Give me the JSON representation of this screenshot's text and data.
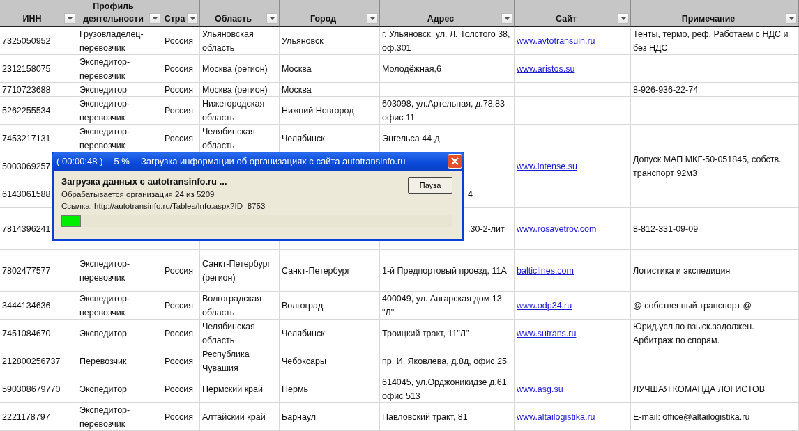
{
  "table": {
    "columns": [
      {
        "label": "ИНН",
        "kind": "text"
      },
      {
        "label": "Профиль деятельности",
        "kind": "text"
      },
      {
        "label": "Стра",
        "kind": "text"
      },
      {
        "label": "Область",
        "kind": "text"
      },
      {
        "label": "Город",
        "kind": "text"
      },
      {
        "label": "Адрес",
        "kind": "text"
      },
      {
        "label": "Сайт",
        "kind": "link"
      },
      {
        "label": "Примечание",
        "kind": "text"
      }
    ],
    "rows": [
      {
        "cells": [
          "7325050952",
          "Грузовладелец-перевозчик",
          "Россия",
          "Ульяновская область",
          "Ульяновск",
          "г. Ульяновск, ул. Л. Толстого 38, оф.301",
          "www.avtotransuln.ru",
          "Тенты, термо, реф. Работаем с НДС и без НДС"
        ]
      },
      {
        "cells": [
          "2312158075",
          "Экспедитор-перевозчик",
          "Россия",
          "Москва (регион)",
          "Москва",
          "Молодёжная,6",
          "www.aristos.su",
          null
        ]
      },
      {
        "cells": [
          "7710723688",
          "Экспедитор",
          "Россия",
          "Москва (регион)",
          "Москва",
          null,
          null,
          "8-926-936-22-74"
        ]
      },
      {
        "cells": [
          "5262255534",
          "Экспедитор-перевозчик",
          "Россия",
          "Нижегородская область",
          "Нижний Новгород",
          "603098, ул.Артельная, д.78,83 офис 11",
          null,
          null
        ]
      },
      {
        "cells": [
          "7453217131",
          "Экспедитор-перевозчик",
          "Россия",
          "Челябинская область",
          "Челябинск",
          "Энгельса 44-д",
          null,
          null
        ]
      },
      {
        "cells": [
          "5003069257",
          null,
          null,
          null,
          null,
          null,
          "www.intense.su",
          "Допуск МАП МКГ-50-051845, собств. транспорт 92м3"
        ]
      },
      {
        "partial": true,
        "cells": [
          "6143061588",
          null,
          null,
          null,
          null,
          "4",
          null,
          null
        ]
      },
      {
        "partial": true,
        "cells": [
          "7814396241",
          null,
          null,
          null,
          null,
          ".30-2-лит",
          "www.rosavetrov.com",
          "8-812-331-09-09"
        ]
      },
      {
        "cells": [
          "7802477577",
          "Экспедитор-перевозчик",
          "Россия",
          "Санкт-Петербург (регион)",
          "Санкт-Петербург",
          "1-й Предпортовый проезд, 11А",
          "balticlines.com",
          "Логистика и экспедиция"
        ]
      },
      {
        "cells": [
          "3444134636",
          "Экспедитор-перевозчик",
          "Россия",
          "Волгоградская область",
          "Волгоград",
          "400049, ул. Ангарская дом 13 \"Л\"",
          "www.odp34.ru",
          "@ собственный транспорт @"
        ]
      },
      {
        "cells": [
          "7451084670",
          "Экспедитор",
          "Россия",
          "Челябинская область",
          "Челябинск",
          "Троицкий тракт, 11\"Л\"",
          "www.sutrans.ru",
          "Юрид.усл.по взыск.задолжен. Арбитраж по спорам."
        ]
      },
      {
        "cells": [
          "212800256737",
          "Перевозчик",
          "Россия",
          "Республика Чувашия",
          "Чебоксары",
          "пр. И. Яковлева, д.8д, офис 25",
          null,
          null
        ]
      },
      {
        "cells": [
          "590308679770",
          "Экспедитор",
          "Россия",
          "Пермский край",
          "Пермь",
          "614045, ул.Орджоникидзе д.61, офис 513",
          "www.asg.su",
          "ЛУЧШАЯ КОМАНДА ЛОГИСТОВ"
        ]
      },
      {
        "cells": [
          "2221178797",
          "Экспедитор-перевозчик",
          "Россия",
          "Алтайский край",
          "Барнаул",
          "Павловский тракт, 81",
          "www.altailogistika.ru",
          "E-mail: office@altailogistika.ru"
        ]
      }
    ]
  },
  "dialog": {
    "elapsed": "( 00:00:48 )",
    "percent": "5 %",
    "title": "Загрузка информации об организациях с сайта autotransinfo.ru",
    "heading": "Загрузка данных с autotransinfo.ru ...",
    "status": "Обрабатывается организация 24 из 5209",
    "link": "Ссылка: http://autotransinfo.ru/Tables/Info.aspx?ID=8753",
    "pause_button": "Пауза",
    "level": 0.05
  }
}
